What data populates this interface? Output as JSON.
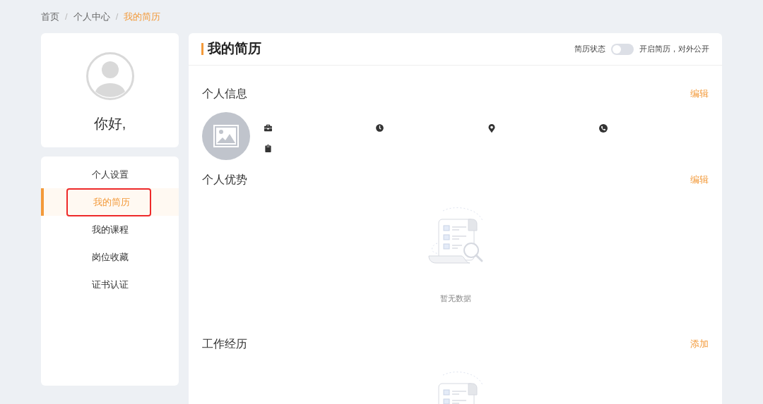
{
  "breadcrumb": [
    {
      "label": "首页",
      "selected": false
    },
    {
      "label": "个人中心",
      "selected": false
    },
    {
      "label": "我的简历",
      "selected": true
    }
  ],
  "breadcrumb_separator": "/",
  "profile": {
    "greeting": "你好,"
  },
  "sidebar": {
    "items": [
      {
        "label": "个人设置",
        "selected": false,
        "highlighted": false
      },
      {
        "label": "我的简历",
        "selected": true,
        "highlighted": true
      },
      {
        "label": "我的课程",
        "selected": false,
        "highlighted": false
      },
      {
        "label": "岗位收藏",
        "selected": false,
        "highlighted": false
      },
      {
        "label": "证书认证",
        "selected": false,
        "highlighted": false
      }
    ]
  },
  "main": {
    "title": "我的简历",
    "status_label": "简历状态",
    "status_toggle": {
      "on": false
    },
    "status_hint": "开启简历，对外公开",
    "sections": [
      {
        "kind": "info",
        "title": "个人信息",
        "action": "编辑"
      },
      {
        "kind": "empty",
        "title": "个人优势",
        "action": "编辑",
        "empty_text": "暂无数据"
      },
      {
        "kind": "empty",
        "title": "工作经历",
        "action": "添加"
      }
    ]
  }
}
